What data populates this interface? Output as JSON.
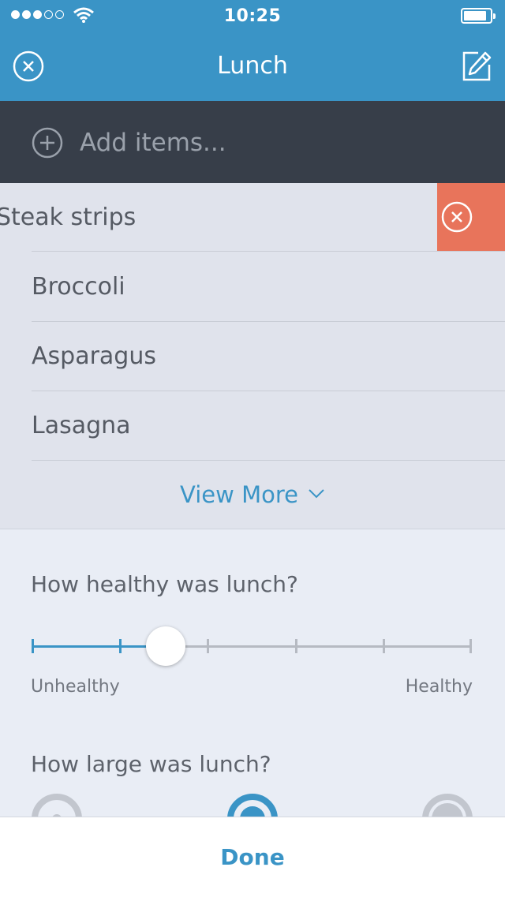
{
  "status_bar": {
    "time": "10:25",
    "signal_bars_filled": 3,
    "signal_bars_total": 5,
    "battery_level": 0.8
  },
  "nav": {
    "title": "Lunch",
    "close_icon": "close-circle-icon",
    "edit_icon": "edit-pencil-icon"
  },
  "add_bar": {
    "placeholder": "Add items...",
    "icon": "plus-circle-icon"
  },
  "items": [
    {
      "label": "Steak strips"
    },
    {
      "label": "Broccoli"
    },
    {
      "label": "Asparagus"
    },
    {
      "label": "Lasagna"
    }
  ],
  "view_more": {
    "label": "View More"
  },
  "healthy": {
    "question": "How healthy was lunch?",
    "min_label": "Unhealthy",
    "max_label": "Healthy",
    "steps": 6,
    "selected_step": 2
  },
  "size": {
    "question": "How large was lunch?",
    "selected": "medium"
  },
  "footer": {
    "done_label": "Done"
  },
  "colors": {
    "accent": "#3a94c6",
    "dark_bar": "#373e49",
    "delete": "#e8745b",
    "list_bg": "#e0e3ec"
  }
}
